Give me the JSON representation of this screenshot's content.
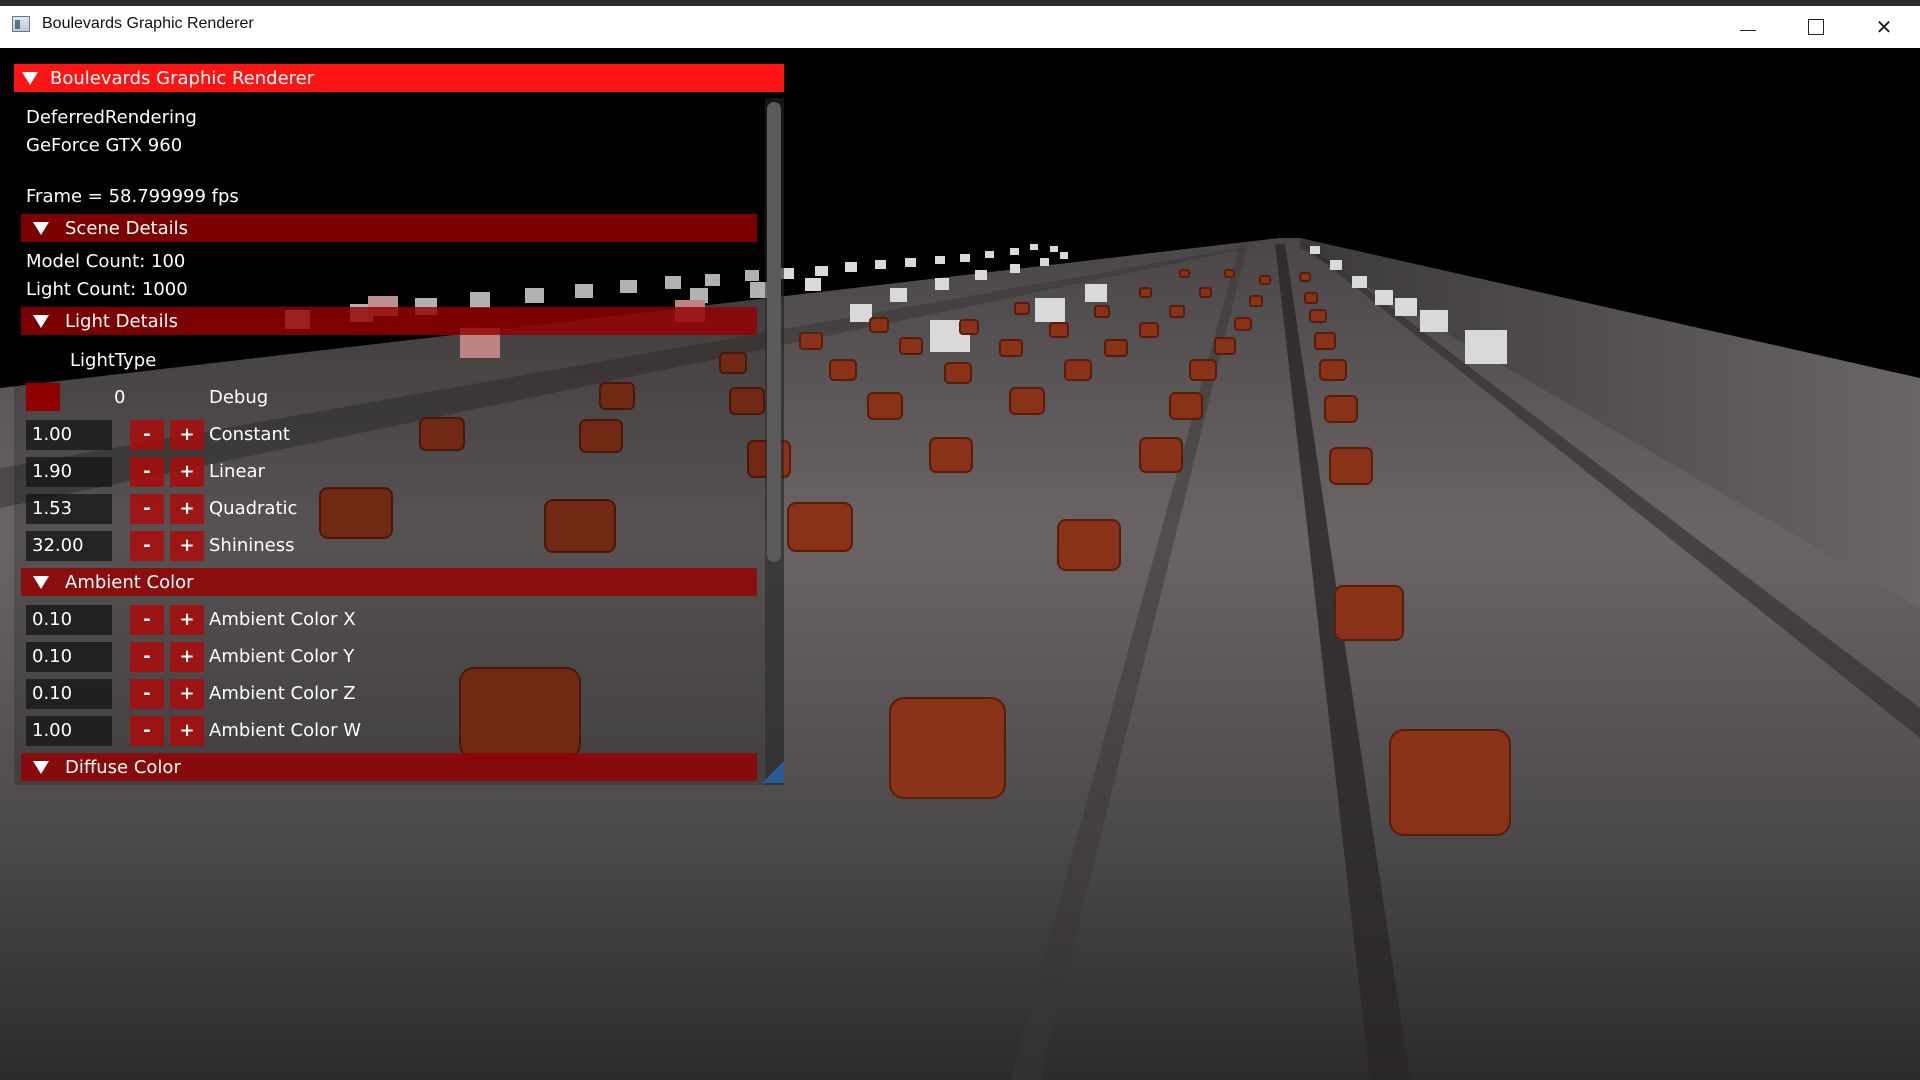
{
  "window": {
    "title": "Boulevards Graphic Renderer",
    "icon": "app-window-icon",
    "controls": [
      "minimize-icon",
      "maximize-icon",
      "close-icon"
    ]
  },
  "panel": {
    "title": "Boulevards Graphic Renderer",
    "renderer": "DeferredRendering",
    "gpu": "GeForce GTX 960",
    "frame": "Frame = 58.799999 fps",
    "scene_section": "Scene Details",
    "model_count": "Model Count: 100",
    "light_count": "Light Count: 1000",
    "light_section": "Light Details",
    "light_type_label": "LightType",
    "debug": {
      "value": "0",
      "label": "Debug",
      "swatch_color": "#8f0000"
    },
    "light_params": [
      {
        "value": "1.00",
        "label": "Constant"
      },
      {
        "value": "1.90",
        "label": "Linear"
      },
      {
        "value": "1.53",
        "label": "Quadratic"
      },
      {
        "value": "32.00",
        "label": "Shininess"
      }
    ],
    "ambient_section": "Ambient Color",
    "ambient_params": [
      {
        "value": "0.10",
        "label": "Ambient Color X"
      },
      {
        "value": "0.10",
        "label": "Ambient Color Y"
      },
      {
        "value": "0.10",
        "label": "Ambient Color Z"
      },
      {
        "value": "1.00",
        "label": "Ambient Color W"
      }
    ],
    "diffuse_section": "Diffuse Color",
    "minus": "-",
    "plus": "+"
  },
  "colors": {
    "header": "#ff1414",
    "section": "#960000",
    "button": "#aa0a0a",
    "floor": "#5e5a5c",
    "sofa": "#8a3218",
    "light_cube": "#d8d8d8"
  }
}
